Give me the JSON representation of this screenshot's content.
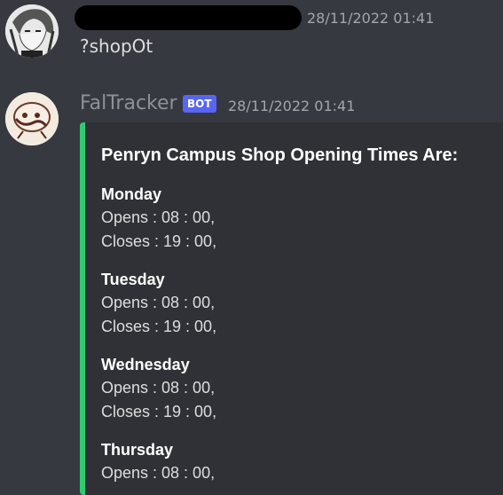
{
  "messages": [
    {
      "timestamp": "28/11/2022 01:41",
      "content": "?shopOt"
    },
    {
      "username": "FalTracker",
      "bot_tag": "BOT",
      "timestamp": "28/11/2022 01:41",
      "embed": {
        "title": "Penryn Campus Shop Opening Times Are:",
        "accent_color": "#2ecc71",
        "days": [
          {
            "name": "Monday",
            "opens": "Opens : 08 : 00,",
            "closes": "Closes : 19 : 00,"
          },
          {
            "name": "Tuesday",
            "opens": "Opens : 08 : 00,",
            "closes": "Closes : 19 : 00,"
          },
          {
            "name": "Wednesday",
            "opens": "Opens : 08 : 00,",
            "closes": "Closes : 19 : 00,"
          },
          {
            "name": "Thursday",
            "opens": "Opens : 08 : 00,",
            "closes": ""
          }
        ]
      }
    }
  ],
  "colors": {
    "background": "#36393f",
    "embed_background": "#2f3136",
    "bot_tag": "#5865f2",
    "username_bot": "#8e9297"
  }
}
